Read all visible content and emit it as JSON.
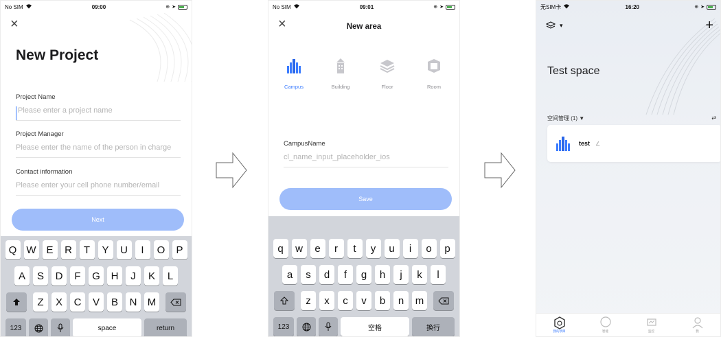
{
  "screen1": {
    "status": {
      "carrier": "No SIM",
      "time": "09:00"
    },
    "title": "New Project",
    "fields": [
      {
        "label": "Project Name",
        "placeholder": "Please enter a project name"
      },
      {
        "label": "Project Manager",
        "placeholder": "Please enter the name of the person in charge"
      },
      {
        "label": "Contact information",
        "placeholder": "Please enter your cell phone number/email"
      }
    ],
    "next_label": "Next",
    "keyboard": {
      "row1": [
        "Q",
        "W",
        "E",
        "R",
        "T",
        "Y",
        "U",
        "I",
        "O",
        "P"
      ],
      "row2": [
        "A",
        "S",
        "D",
        "F",
        "G",
        "H",
        "J",
        "K",
        "L"
      ],
      "row3": [
        "Z",
        "X",
        "C",
        "V",
        "B",
        "N",
        "M"
      ],
      "num_key": "123",
      "space": "space",
      "return": "return"
    }
  },
  "screen2": {
    "status": {
      "carrier": "No SIM",
      "time": "09:01"
    },
    "title": "New area",
    "types": [
      {
        "label": "Campus",
        "icon": "campus-icon",
        "active": true
      },
      {
        "label": "Building",
        "icon": "building-icon",
        "active": false
      },
      {
        "label": "Floor",
        "icon": "floor-icon",
        "active": false
      },
      {
        "label": "Room",
        "icon": "room-icon",
        "active": false
      }
    ],
    "field_label": "CampusName",
    "field_placeholder": "cl_name_input_placeholder_ios",
    "save_label": "Save",
    "keyboard": {
      "row1": [
        "q",
        "w",
        "e",
        "r",
        "t",
        "y",
        "u",
        "i",
        "o",
        "p"
      ],
      "row2": [
        "a",
        "s",
        "d",
        "f",
        "g",
        "h",
        "j",
        "k",
        "l"
      ],
      "row3": [
        "z",
        "x",
        "c",
        "v",
        "b",
        "n",
        "m"
      ],
      "num_key": "123",
      "space": "空格",
      "return": "换行"
    }
  },
  "screen3": {
    "status": {
      "carrier": "无SIM卡",
      "time": "16:20"
    },
    "title": "Test space",
    "section_title": "空间管理 (1) ▼",
    "space": {
      "name": "test",
      "edit": "∠"
    },
    "tabs": [
      {
        "label": "我的项目",
        "icon": "home-icon",
        "active": true
      },
      {
        "label": "智能",
        "icon": "bulb-icon",
        "active": false
      },
      {
        "label": "监控",
        "icon": "monitor-icon",
        "active": false
      },
      {
        "label": "我",
        "icon": "user-icon",
        "active": false
      }
    ]
  },
  "colors": {
    "accent": "#3b7cff",
    "button": "#9fbdfa",
    "keyboard": "#d2d5db"
  }
}
